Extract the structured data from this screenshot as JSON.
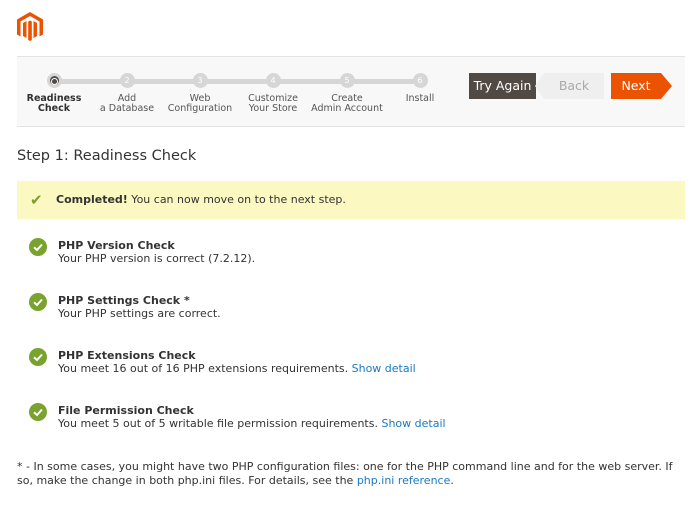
{
  "brand": {
    "logo": "magento-logo",
    "color": "#eb5202"
  },
  "steps": [
    {
      "num": "",
      "label1": "Readiness",
      "label2": "Check",
      "active": true
    },
    {
      "num": "2",
      "label1": "Add",
      "label2": "a Database"
    },
    {
      "num": "3",
      "label1": "Web",
      "label2": "Configuration"
    },
    {
      "num": "4",
      "label1": "Customize",
      "label2": "Your Store"
    },
    {
      "num": "5",
      "label1": "Create",
      "label2": "Admin Account"
    },
    {
      "num": "6",
      "label1": "Install",
      "label2": ""
    }
  ],
  "buttons": {
    "try_again": "Try Again",
    "back": "Back",
    "next": "Next"
  },
  "title": "Step 1: Readiness Check",
  "banner": {
    "strong": "Completed!",
    "text": " You can now move on to the next step.",
    "icon": "check-icon",
    "bg": "#fbf9c1"
  },
  "checks": [
    {
      "title": "PHP Version Check",
      "text": "Your PHP version is correct (7.2.12).",
      "link": ""
    },
    {
      "title": "PHP Settings Check *",
      "text": "Your PHP settings are correct.",
      "link": ""
    },
    {
      "title": "PHP Extensions Check",
      "text": "You meet 16 out of 16 PHP extensions requirements. ",
      "link": "Show detail"
    },
    {
      "title": "File Permission Check",
      "text": "You meet 5 out of 5 writable file permission requirements. ",
      "link": "Show detail"
    }
  ],
  "footnote": {
    "text": "* - In some cases, you might have two PHP configuration files: one for the PHP command line and for the web server. If so, make the change in both php.ini files. For details, see the ",
    "link": "php.ini reference",
    "end": "."
  }
}
